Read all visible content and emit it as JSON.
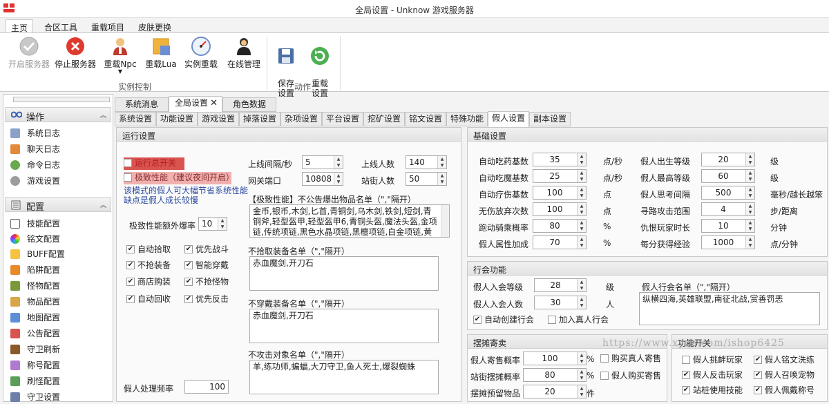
{
  "window": {
    "title": "全局设置 - Unknow 游戏服务器"
  },
  "ribbon": {
    "tabs": [
      "主页",
      "合区工具",
      "重载项目",
      "皮肤更换"
    ],
    "buttons": [
      "开启服务器",
      "停止服务器",
      "重载Npc",
      "重载Lua",
      "实例重载",
      "在线管理",
      "保存\n设置",
      "重载\n设置"
    ],
    "groups": [
      "实例控制",
      "动作"
    ]
  },
  "sidebar": {
    "sections": [
      {
        "title": "操作",
        "items": [
          "系统日志",
          "聊天日志",
          "命令日志",
          "游戏设置"
        ]
      },
      {
        "title": "配置",
        "items": [
          "技能配置",
          "铭文配置",
          "BUFF配置",
          "陷阱配置",
          "怪物配置",
          "物品配置",
          "地图配置",
          "公告配置",
          "守卫刷新",
          "称号配置",
          "刷怪配置",
          "守卫设置"
        ]
      }
    ]
  },
  "tabs1": [
    "系统消息",
    "全局设置",
    "角色数据"
  ],
  "tabs2": [
    "系统设置",
    "功能设置",
    "游戏设置",
    "掉落设置",
    "杂项设置",
    "平台设置",
    "挖矿设置",
    "铭文设置",
    "特殊功能",
    "假人设置",
    "副本设置"
  ],
  "run": {
    "title": "运行设置",
    "master": "运行总开关",
    "extreme": "极致性能（建议夜间开启）",
    "note": "该模式的假人可大幅节省系统性能\n缺点是假人成长较慢",
    "drop_label": "极致性能额外爆率",
    "drop_value": "10",
    "checks": [
      "自动拾取",
      "优先战斗",
      "不抢装备",
      "智能穿戴",
      "商店购装",
      "不抢怪物",
      "自动回收",
      "优先反击"
    ],
    "online_interval_label": "上线间隔/秒",
    "online_interval": "5",
    "online_count_label": "上线人数",
    "online_count": "140",
    "port_label": "网关端口",
    "port": "10808",
    "stand_label": "站街人数",
    "stand": "50",
    "extreme_list_label": "【极致性能】不公告爆出物品名单（\",\"隔开）",
    "extreme_list": "金币,银币,木剑,匕首,青铜剑,乌木剑,铁剑,短剑,青铜斧,轻型盔甲,轻型盔甲6,青铜头盔,魔法头盔,金项链,传统项链,黑色水晶项链,黑檀项链,白金项链,黄色水晶项链,铁手镯,皮制手套,银手镯,大手镯,钢手镯,古铜戒指,六",
    "nopick_label": "不拾取装备名单（\",\"隔开）",
    "nopick": "赤血魔剑,开刀石",
    "nowear_label": "不穿戴装备名单（\",\"隔开）",
    "nowear": "赤血魔剑,开刀石",
    "noattack_label": "不攻击对象名单（\",\"隔开）",
    "noattack": "羊,练功师,蝙蝠,大刀守卫,鱼人死士,爆裂蜘蛛",
    "freq_label": "假人处理频率",
    "freq": "100"
  },
  "basic": {
    "title": "基础设置",
    "left": [
      {
        "label": "自动吃药基数",
        "value": "35",
        "unit": "点/秒"
      },
      {
        "label": "自动吃魔基数",
        "value": "25",
        "unit": "点/秒"
      },
      {
        "label": "自动疗伤基数",
        "value": "100",
        "unit": "点"
      },
      {
        "label": "无伤放弃次数",
        "value": "100",
        "unit": "点"
      },
      {
        "label": "跑动骑乘概率",
        "value": "80",
        "unit": "%"
      },
      {
        "label": "假人属性加成",
        "value": "70",
        "unit": "%"
      }
    ],
    "right": [
      {
        "label": "假人出生等级",
        "value": "20",
        "unit": "级"
      },
      {
        "label": "假人最高等级",
        "value": "60",
        "unit": "级"
      },
      {
        "label": "假人思考间隔",
        "value": "500",
        "unit": "毫秒/越长越笨"
      },
      {
        "label": "寻路攻击范围",
        "value": "4",
        "unit": "步/距离"
      },
      {
        "label": "仇恨玩家时长",
        "value": "10",
        "unit": "分钟"
      },
      {
        "label": "每分获得经验",
        "value": "1000",
        "unit": "点/分钟"
      }
    ]
  },
  "guild": {
    "title": "行会功能",
    "level_label": "假人入会等级",
    "level": "28",
    "level_unit": "级",
    "count_label": "假人入会人数",
    "count": "30",
    "count_unit": "人",
    "names_label": "假人行会名单（\",\"隔开）",
    "names": "纵横四海,英雄联盟,南征北战,赏善罚恶",
    "auto_create": "自动创建行会",
    "add_real": "加入真人行会"
  },
  "stall": {
    "title": "摆摊寄卖",
    "rows": [
      {
        "label": "假人寄售概率",
        "value": "100",
        "unit": "%"
      },
      {
        "label": "站街摆摊概率",
        "value": "80",
        "unit": "%"
      },
      {
        "label": "摆摊预留物品",
        "value": "20",
        "unit": "件"
      }
    ],
    "checks": [
      "购买真人寄售",
      "假人购买寄售"
    ]
  },
  "func": {
    "title": "功能开关",
    "checks": [
      "假人挑衅玩家",
      "假人铭文洗练",
      "假人反击玩家",
      "假人召唤宠物",
      "站桩使用技能",
      "假人佩戴称号"
    ]
  },
  "watermark": "https://www.xyzn.com/ishop6425"
}
